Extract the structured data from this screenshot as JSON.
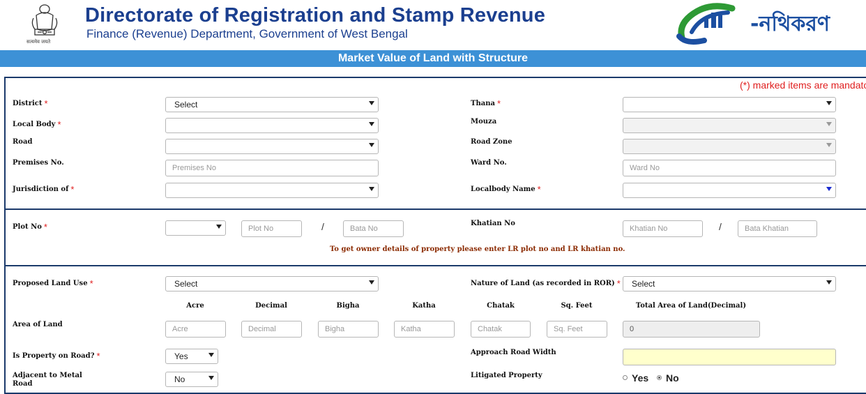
{
  "header": {
    "title": "Directorate of Registration and Stamp Revenue",
    "subtitle": "Finance (Revenue) Department, Government of West Bengal",
    "emblem_caption": "सत्यमेव जयते",
    "logo_text": "-নথিকরণ"
  },
  "banner": {
    "title": "Market Value of Land with Structure"
  },
  "form": {
    "mandatory_note": "(*) marked items are mandatory",
    "required_mark": "*",
    "district": {
      "label": "District",
      "value": "Select"
    },
    "thana": {
      "label": "Thana",
      "value": ""
    },
    "local_body": {
      "label": "Local Body",
      "value": ""
    },
    "mouza": {
      "label": "Mouza",
      "value": ""
    },
    "road": {
      "label": "Road",
      "value": ""
    },
    "road_zone": {
      "label": "Road Zone",
      "value": ""
    },
    "premises_no": {
      "label": "Premises No.",
      "placeholder": "Premises No"
    },
    "ward_no": {
      "label": "Ward No.",
      "placeholder": "Ward No"
    },
    "jurisdiction": {
      "label": "Jurisdiction of",
      "value": ""
    },
    "localbody_name": {
      "label": "Localbody Name",
      "value": ""
    },
    "plot_no": {
      "label": "Plot No",
      "value": "",
      "plot_placeholder": "Plot No",
      "bata_placeholder": "Bata No"
    },
    "khatian_no": {
      "label": "Khatian No",
      "khatian_placeholder": "Khatian No",
      "bata_placeholder": "Bata Khatian"
    },
    "separator": "/",
    "lr_note": "To get owner details of property please enter LR plot no and LR khatian no.",
    "proposed_land_use": {
      "label": "Proposed Land Use",
      "value": "Select"
    },
    "nature_of_land": {
      "label": "Nature of Land (as recorded in ROR)",
      "value": "Select"
    },
    "area_headers": [
      "Acre",
      "Decimal",
      "Bigha",
      "Katha",
      "Chatak",
      "Sq. Feet",
      "Total Area of Land(Decimal)"
    ],
    "area_of_land": {
      "label": "Area of Land",
      "placeholders": [
        "Acre",
        "Decimal",
        "Bigha",
        "Katha",
        "Chatak",
        "Sq. Feet"
      ],
      "total": "0"
    },
    "property_on_road": {
      "label": "Is Property on Road?",
      "value": "Yes"
    },
    "approach_road_width": {
      "label": "Approach Road Width",
      "value": ""
    },
    "adjacent_metal_road": {
      "label": "Adjacent to Metal Road",
      "value": "No"
    },
    "litigated_property": {
      "label": "Litigated Property",
      "options": [
        "Yes",
        "No"
      ],
      "selected": "No"
    }
  },
  "colors": {
    "brand_blue": "#1b3f8f",
    "banner": "#3d91d6",
    "required": "#e02020",
    "note": "#8b2a00"
  }
}
